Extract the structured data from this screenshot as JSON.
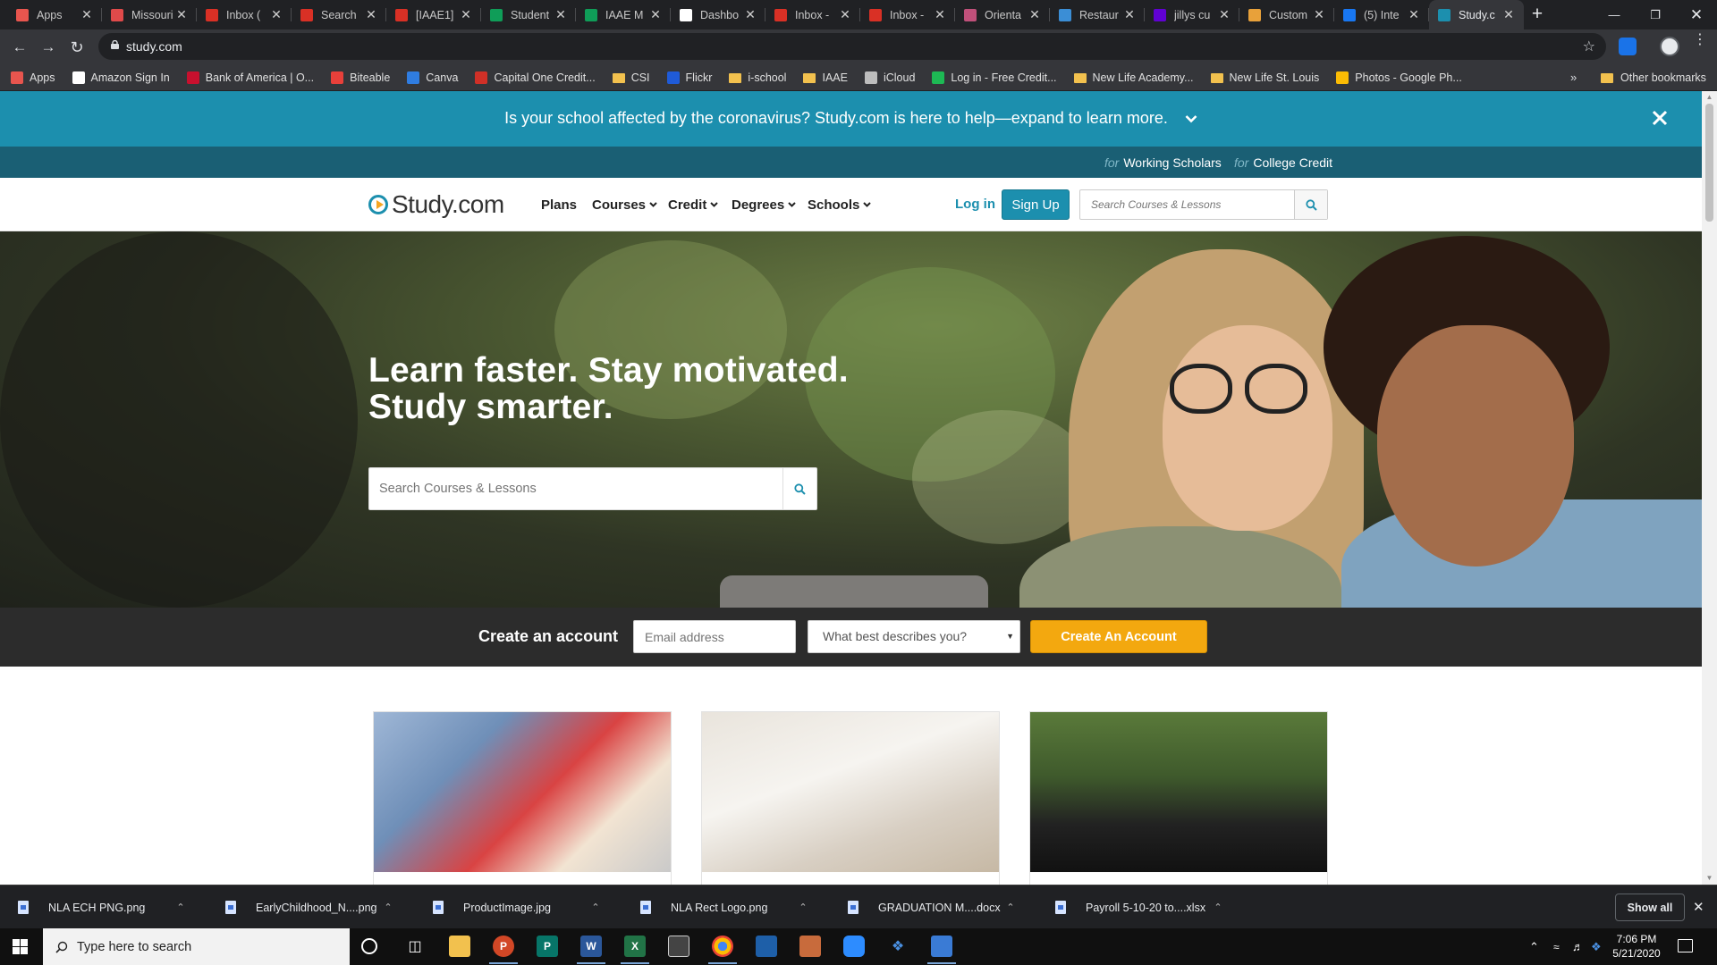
{
  "browser": {
    "tabs": [
      {
        "title": "Apps",
        "fav_color": "#e8554e"
      },
      {
        "title": "Missouri",
        "fav_color": "#e04a4a"
      },
      {
        "title": "Inbox (",
        "fav_color": "#d93025"
      },
      {
        "title": "Search",
        "fav_color": "#d93025"
      },
      {
        "title": "[IAAE1]",
        "fav_color": "#d93025"
      },
      {
        "title": "Student",
        "fav_color": "#0f9d58"
      },
      {
        "title": "IAAE M",
        "fav_color": "#0f9d58"
      },
      {
        "title": "Dashbo",
        "fav_color": "#ffffff"
      },
      {
        "title": "Inbox -",
        "fav_color": "#d93025"
      },
      {
        "title": "Inbox -",
        "fav_color": "#d93025"
      },
      {
        "title": "Orienta",
        "fav_color": "#c0507a"
      },
      {
        "title": "Restaur",
        "fav_color": "#3b8ed6"
      },
      {
        "title": "jillys cu",
        "fav_color": "#6001d2"
      },
      {
        "title": "Custom",
        "fav_color": "#e8a13a"
      },
      {
        "title": "(5) Inte",
        "fav_color": "#1877f2"
      },
      {
        "title": "Study.c",
        "fav_color": "#1c8fae"
      }
    ],
    "url": "study.com",
    "bookmarks": [
      {
        "label": "Apps",
        "icon": "apps-grid-icon",
        "color": "#e8554e"
      },
      {
        "label": "Amazon Sign In",
        "icon": "amazon-icon",
        "color": "#ffffff"
      },
      {
        "label": "Bank of America | O...",
        "icon": "bank-icon",
        "color": "#c8102e"
      },
      {
        "label": "Biteable",
        "icon": "biteable-icon",
        "color": "#e8403a"
      },
      {
        "label": "Canva",
        "icon": "canva-icon",
        "color": "#2f7de1"
      },
      {
        "label": "Capital One Credit...",
        "icon": "capital-one-icon",
        "color": "#d03027"
      },
      {
        "label": "CSI",
        "icon": "folder-icon",
        "color": "#f2c14e"
      },
      {
        "label": "Flickr",
        "icon": "flickr-icon",
        "color": "#1f5bd8"
      },
      {
        "label": "i-school",
        "icon": "folder-icon",
        "color": "#f2c14e"
      },
      {
        "label": "IAAE",
        "icon": "folder-icon",
        "color": "#f2c14e"
      },
      {
        "label": "iCloud",
        "icon": "apple-icon",
        "color": "#bdbdbd"
      },
      {
        "label": "Log in - Free Credit...",
        "icon": "ck-icon",
        "color": "#1db954"
      },
      {
        "label": "New Life Academy...",
        "icon": "folder-icon",
        "color": "#f2c14e"
      },
      {
        "label": "New Life St. Louis",
        "icon": "folder-icon",
        "color": "#f2c14e"
      },
      {
        "label": "Photos - Google Ph...",
        "icon": "google-photos-icon",
        "color": "#fbbc04"
      }
    ],
    "bookmarks_more": "»",
    "other_bookmarks": "Other bookmarks"
  },
  "page": {
    "alert_text": "Is your school affected by the coronavirus? Study.com is here to help—expand to learn more.",
    "top_links": [
      {
        "for": "for",
        "label": "Working Scholars"
      },
      {
        "for": "for",
        "label": "College Credit"
      }
    ],
    "logo_text": "Study.com",
    "nav": [
      {
        "label": "Plans",
        "dropdown": false
      },
      {
        "label": "Courses",
        "dropdown": true
      },
      {
        "label": "Credit",
        "dropdown": true
      },
      {
        "label": "Degrees",
        "dropdown": true
      },
      {
        "label": "Schools",
        "dropdown": true
      }
    ],
    "login_label": "Log in",
    "signup_label": "Sign Up",
    "header_search_placeholder": "Search Courses & Lessons",
    "hero_line1": "Learn faster. Stay motivated.",
    "hero_line2": "Study smarter.",
    "hero_search_placeholder": "Search Courses & Lessons",
    "account": {
      "label": "Create an account",
      "email_placeholder": "Email address",
      "describe_selected": "What best describes you?",
      "button": "Create An Account"
    },
    "accent": "#1c8fae",
    "cta_color": "#f3a80f"
  },
  "downloads": {
    "items": [
      {
        "name": "NLA ECH PNG.png"
      },
      {
        "name": "EarlyChildhood_N....png"
      },
      {
        "name": "ProductImage.jpg"
      },
      {
        "name": "NLA Rect Logo.png"
      },
      {
        "name": "GRADUATION M....docx"
      },
      {
        "name": "Payroll 5-10-20 to....xlsx"
      }
    ],
    "show_all": "Show all"
  },
  "taskbar": {
    "search_placeholder": "Type here to search",
    "time": "7:06 PM",
    "date": "5/21/2020"
  }
}
